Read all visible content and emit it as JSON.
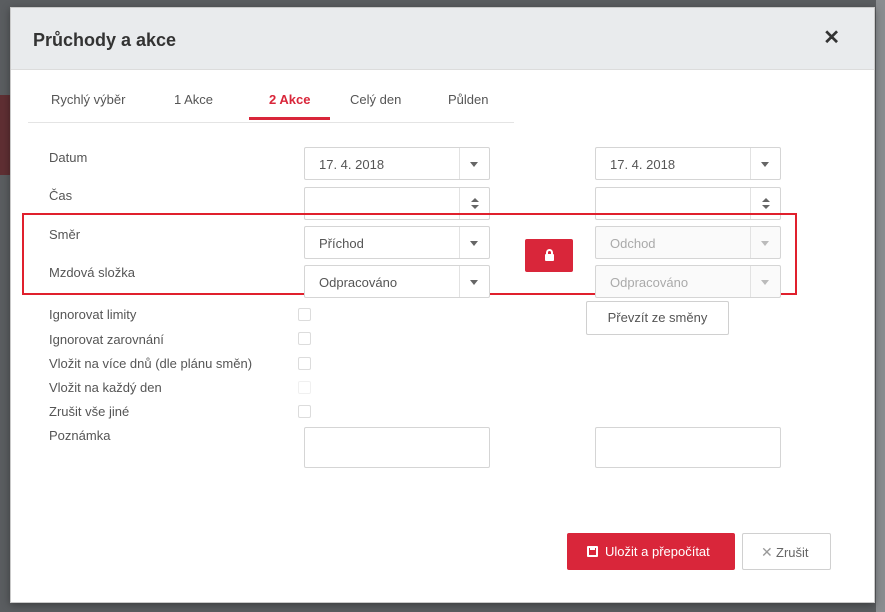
{
  "modal": {
    "title": "Průchody a akce",
    "close_glyph": "✕"
  },
  "tabs": [
    {
      "label": "Rychlý výběr"
    },
    {
      "label": "1 Akce"
    },
    {
      "label": "2 Akce",
      "active": true
    },
    {
      "label": "Celý den"
    },
    {
      "label": "Půlden"
    }
  ],
  "form": {
    "labels": {
      "datum": "Datum",
      "cas": "Čas",
      "smer": "Směr",
      "mzdova_slozka": "Mzdová složka",
      "ignorovat_limity": "Ignorovat limity",
      "ignorovat_zarovnani": "Ignorovat zarovnání",
      "vlozit_vice_dnu": "Vložit na více dnů (dle plánu směn)",
      "vlozit_kazdy_den": "Vložit na každý den",
      "zrusit_vse_jine": "Zrušit vše jiné",
      "poznamka": "Poznámka"
    },
    "left": {
      "datum": "17. 4. 2018",
      "cas": "",
      "smer": "Příchod",
      "mzdova_slozka": "Odpracováno",
      "poznamka": ""
    },
    "right": {
      "datum": "17. 4. 2018",
      "cas": "",
      "smer": "Odchod",
      "mzdova_slozka": "Odpracováno",
      "poznamka": ""
    },
    "checkboxes": {
      "ignorovat_limity": false,
      "ignorovat_zarovnani": false,
      "vlozit_vice_dnu": false,
      "vlozit_kazdy_den": false,
      "zrusit_vse_jine": false
    },
    "prevzit_label": "Převzít ze směny"
  },
  "footer": {
    "save_label": "Uložit a přepočítat",
    "cancel_label": "Zrušit",
    "cancel_glyph": "✕"
  },
  "colors": {
    "accent": "#d9263a",
    "highlight_border": "#e0202d",
    "header_bg": "#e9ebed"
  },
  "icons": {
    "close": "close-icon",
    "lock": "lock-icon",
    "save": "save-icon",
    "cancel": "x-icon",
    "select_caret": "chevron-down-icon",
    "spinner": "spinner-arrows-icon"
  }
}
